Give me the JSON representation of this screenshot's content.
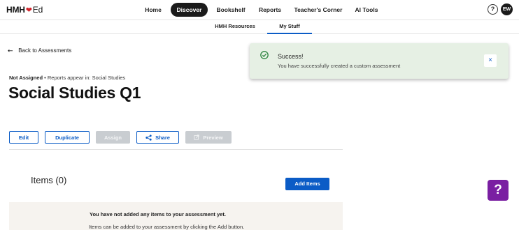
{
  "brand": {
    "logo_prefix": "HMH",
    "logo_suffix": "Ed"
  },
  "nav": {
    "items": [
      {
        "label": "Home"
      },
      {
        "label": "Discover",
        "active": true
      },
      {
        "label": "Bookshelf"
      },
      {
        "label": "Reports"
      },
      {
        "label": "Teacher's Corner"
      },
      {
        "label": "AI Tools"
      }
    ],
    "help_label": "?",
    "avatar_initials": "EW"
  },
  "subnav": {
    "items": [
      {
        "label": "HMH Resources"
      },
      {
        "label": "My Stuff",
        "active": true
      }
    ]
  },
  "back_link": {
    "arrow": "⭠",
    "label": "Back to Assessments"
  },
  "status": {
    "assignment": "Not Assigned",
    "separator": " • ",
    "reports_prefix": "Reports appear in: ",
    "reports_value": "Social Studies"
  },
  "page_title": "Social Studies Q1",
  "actions": {
    "edit": "Edit",
    "duplicate": "Duplicate",
    "assign": "Assign",
    "share": "Share",
    "preview": "Preview"
  },
  "items": {
    "title": "Items (0)",
    "add_button": "Add Items",
    "empty_line1": "You have not added any items to your assessment yet.",
    "empty_line2": "Items can be added to your assessment by clicking the Add button."
  },
  "toast": {
    "title": "Success!",
    "message": "You have successfully created a custom assessment",
    "close_icon": "×"
  },
  "chat_help": {
    "label": "?"
  },
  "colors": {
    "accent": "#0b5cc6",
    "success_bg": "#e6f0e4",
    "success_icon": "#2e8540",
    "chat_help": "#7a1fa2"
  }
}
